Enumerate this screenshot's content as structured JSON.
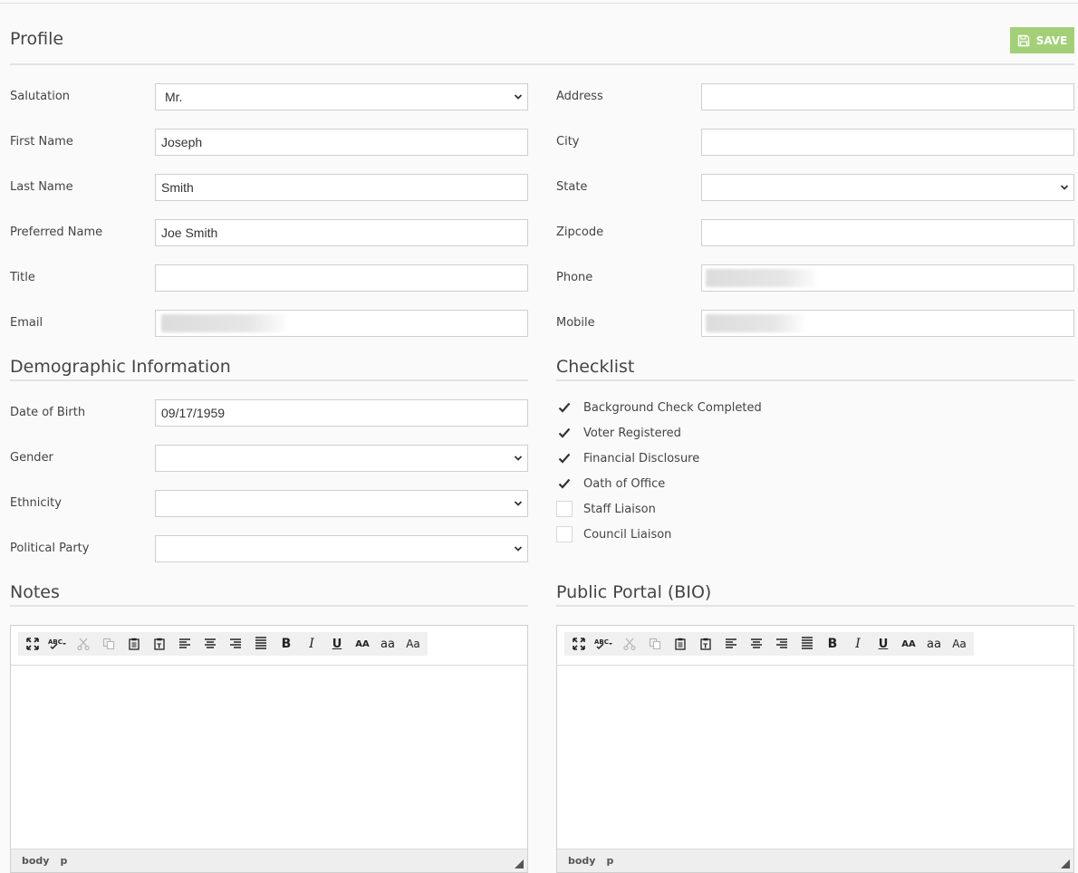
{
  "profile": {
    "title": "Profile",
    "save_label": "SAVE"
  },
  "fields_left": {
    "salutation": {
      "label": "Salutation",
      "value": "Mr."
    },
    "first_name": {
      "label": "First Name",
      "value": "Joseph"
    },
    "last_name": {
      "label": "Last Name",
      "value": "Smith"
    },
    "preferred_name": {
      "label": "Preferred Name",
      "value": "Joe Smith"
    },
    "title": {
      "label": "Title",
      "value": ""
    },
    "email": {
      "label": "Email",
      "value": ""
    }
  },
  "fields_right": {
    "address": {
      "label": "Address",
      "value": ""
    },
    "city": {
      "label": "City",
      "value": ""
    },
    "state": {
      "label": "State",
      "value": ""
    },
    "zipcode": {
      "label": "Zipcode",
      "value": ""
    },
    "phone": {
      "label": "Phone",
      "value": ""
    },
    "mobile": {
      "label": "Mobile",
      "value": ""
    }
  },
  "demographic": {
    "title": "Demographic Information",
    "date_of_birth": {
      "label": "Date of Birth",
      "value": "09/17/1959"
    },
    "gender": {
      "label": "Gender",
      "value": ""
    },
    "ethnicity": {
      "label": "Ethnicity",
      "value": ""
    },
    "political_party": {
      "label": "Political Party",
      "value": ""
    }
  },
  "checklist": {
    "title": "Checklist",
    "items": [
      {
        "label": "Background Check Completed",
        "checked": true
      },
      {
        "label": "Voter Registered",
        "checked": true
      },
      {
        "label": "Financial Disclosure",
        "checked": true
      },
      {
        "label": "Oath of Office",
        "checked": true
      },
      {
        "label": "Staff Liaison",
        "checked": false
      },
      {
        "label": "Council Liaison",
        "checked": false
      }
    ]
  },
  "notes": {
    "title": "Notes",
    "footer_path": [
      "body",
      "p"
    ]
  },
  "bio": {
    "title": "Public Portal (BIO)",
    "footer_path": [
      "body",
      "p"
    ]
  },
  "toolbar_icons": [
    "maximize-icon",
    "spellcheck-icon",
    "cut-icon",
    "copy-icon",
    "paste-icon",
    "paste-text-icon",
    "align-left-icon",
    "align-center-icon",
    "align-right-icon",
    "justify-icon",
    "bold-icon",
    "italic-icon",
    "underline-icon",
    "uppercase-icon",
    "lowercase-icon",
    "sentence-case-icon"
  ],
  "colors": {
    "save_button": "#a3cf78",
    "checkmark": "#333333"
  }
}
